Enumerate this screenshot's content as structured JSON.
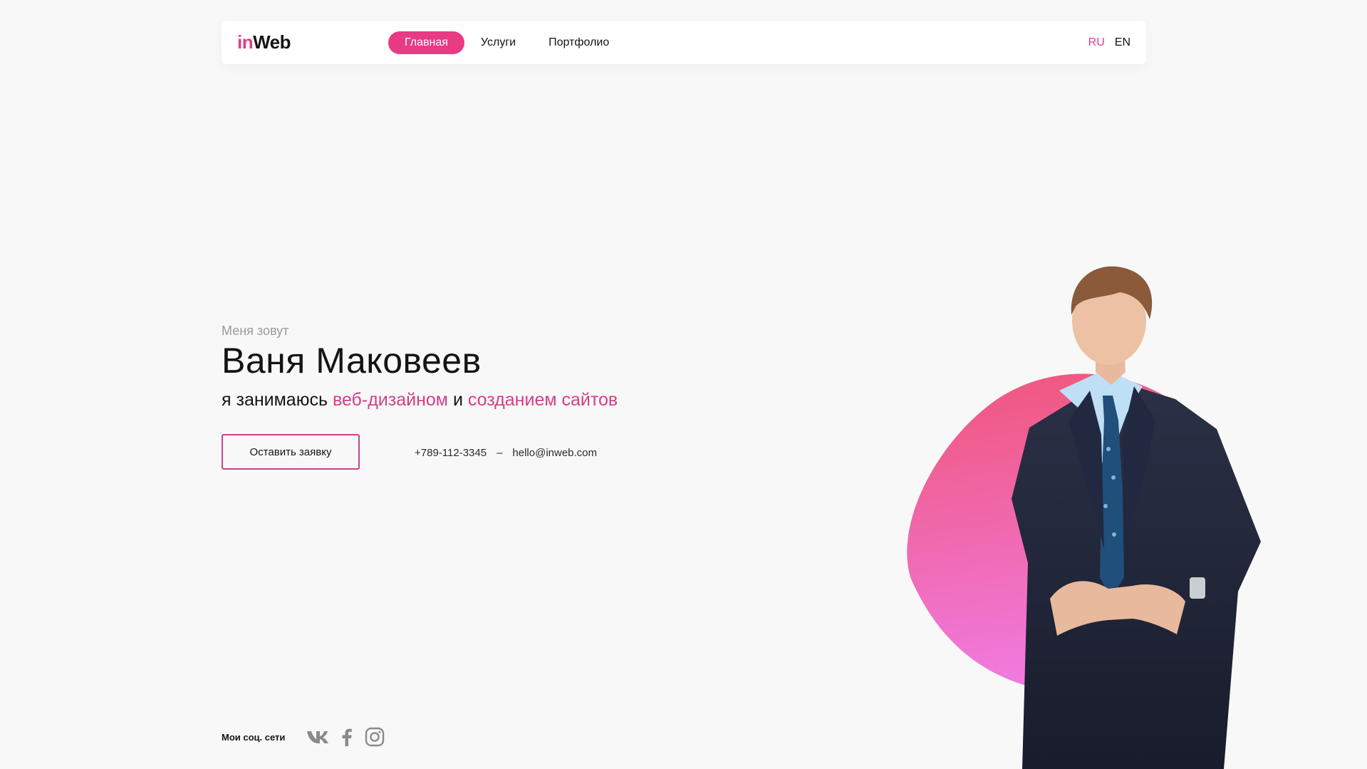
{
  "header": {
    "logo": {
      "accent": "in",
      "rest": "Web"
    },
    "nav": [
      {
        "label": "Главная",
        "active": true
      },
      {
        "label": "Услуги",
        "active": false
      },
      {
        "label": "Портфолио",
        "active": false
      }
    ],
    "languages": {
      "ru": "RU",
      "en": "EN"
    }
  },
  "hero": {
    "intro": "Меня зовут",
    "name": "Ваня Маковеев",
    "tagline": {
      "prefix": "я занимаюсь ",
      "highlight1": "веб-дизайном",
      "middle": " и ",
      "highlight2": "созданием сайтов"
    },
    "cta_label": "Оставить заявку",
    "phone": "+789-112-3345",
    "separator": "–",
    "email": "hello@inweb.com",
    "photo_icon": "man-in-suit-photo"
  },
  "social": {
    "label": "Мои соц. сети",
    "icons": [
      "vk-icon",
      "facebook-icon",
      "instagram-icon"
    ]
  },
  "colors": {
    "accent": "#e93a84",
    "background": "#f8f8f8",
    "text": "#141414",
    "blob_top": "#f0567a",
    "blob_bottom": "#f07be0"
  }
}
